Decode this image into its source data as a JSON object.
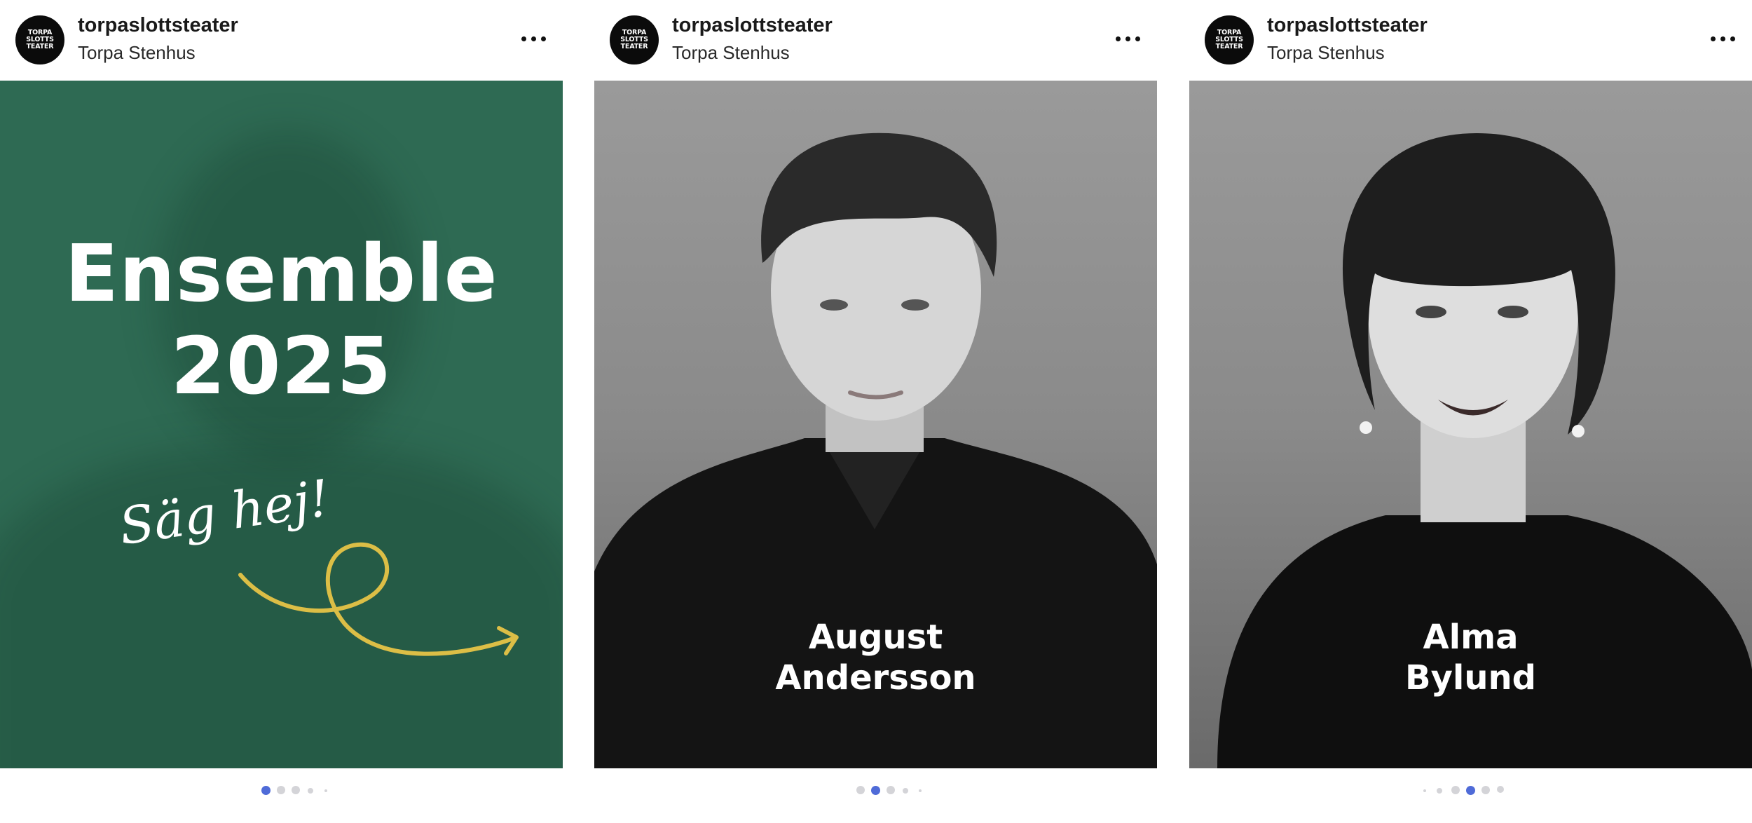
{
  "posts": [
    {
      "username": "torpaslottsteater",
      "location": "Torpa Stenhus",
      "avatar_text": [
        "TORPA",
        "SLOTTS",
        "TEATER"
      ],
      "slide": {
        "title_line1": "Ensemble",
        "title_line2": "2025",
        "script_text": "Säg hej!",
        "bg_color": "#2e6a53",
        "accent_color": "#dcbe46"
      },
      "carousel": {
        "count": 5,
        "active": 1
      }
    },
    {
      "username": "torpaslottsteater",
      "location": "Torpa Stenhus",
      "avatar_text": [
        "TORPA",
        "SLOTTS",
        "TEATER"
      ],
      "slide": {
        "name_line1": "August",
        "name_line2": "Andersson"
      },
      "carousel": {
        "count": 5,
        "active": 2
      }
    },
    {
      "username": "torpaslottsteater",
      "location": "Torpa Stenhus",
      "avatar_text": [
        "TORPA",
        "SLOTTS",
        "TEATER"
      ],
      "slide": {
        "name_line1": "Alma",
        "name_line2": "Bylund"
      },
      "carousel": {
        "count": 6,
        "active": 4
      }
    }
  ],
  "icons": {
    "more": "more-horizontal-icon"
  },
  "colors": {
    "dot_active": "#4f6bd8",
    "dot_inactive": "#d4d4d8"
  }
}
